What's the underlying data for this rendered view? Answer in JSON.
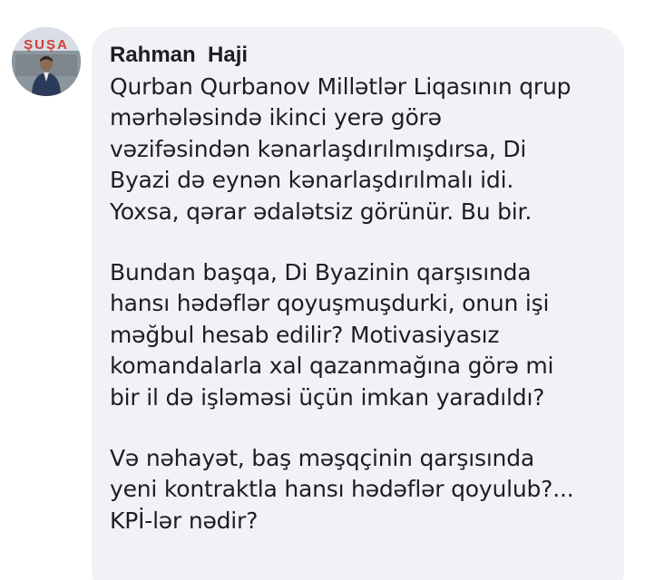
{
  "comment": {
    "avatar_sign_text": "ŞUŞA",
    "author_name": "Rahman  Haji",
    "paragraphs": [
      [
        "Qurban Qurbanov Millətlər Liqasının qrup",
        "mərhələsində ikinci yerə görə",
        "vəzifəsindən kənarlaşdırılmışdırsa, Di",
        "Byazi də eynən kənarlaşdırılmalı idi.",
        "Yoxsa, qərar ədalətsiz görünür. Bu bir."
      ],
      [
        "Bundan başqa, Di Byazinin qarşısında",
        "hansı hədəflər qoyuşmuşdurki, onun işi",
        "məğbul hesab edilir? Motivasiyasız",
        "komandalarla xal qazanmağına görə mi",
        "bir il də işləməsi üçün imkan yaradıldı?"
      ],
      [
        "Və nəhayət, baş məşqçinin qarşısında",
        "yeni kontraktla hansı hədəflər qoyulub?...",
        "KPİ-lər nədir?"
      ]
    ]
  },
  "colors": {
    "bubble_background": "#f0f2f5",
    "text": "#1c1e21",
    "sign_letters": "#d23a3a"
  }
}
